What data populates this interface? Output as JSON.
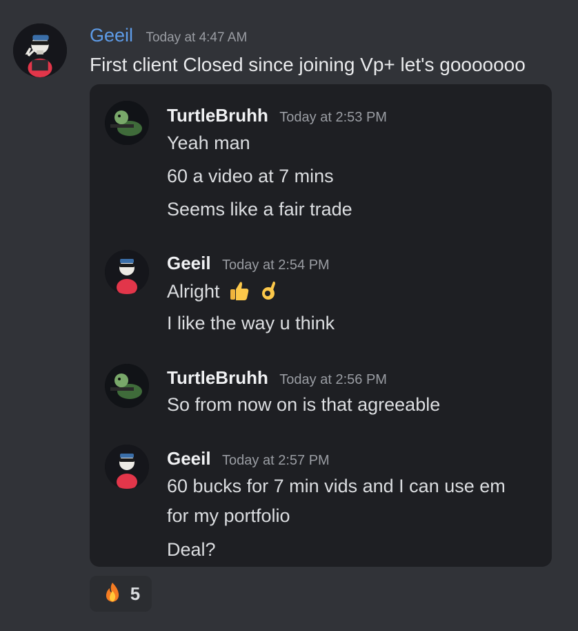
{
  "message": {
    "author": "Geeil",
    "timestamp": "Today at 4:47 AM",
    "text": "First client Closed since joining Vp+ let's gooooooo",
    "author_color": "#5e9ce8"
  },
  "quoted": [
    {
      "author": "TurtleBruhh",
      "timestamp": "Today at 2:53 PM",
      "avatar": "turtle-avatar",
      "lines": [
        "Yeah man",
        "60 a video at 7 mins",
        "Seems like a fair trade"
      ]
    },
    {
      "author": "Geeil",
      "timestamp": "Today at 2:54 PM",
      "avatar": "skeleton-avatar",
      "lines": [
        "Alright",
        "I like the way u think"
      ],
      "emojis": [
        "thumbs-up-icon",
        "ok-hand-icon"
      ]
    },
    {
      "author": "TurtleBruhh",
      "timestamp": "Today at 2:56 PM",
      "avatar": "turtle-avatar",
      "lines": [
        "So from now on is that agreeable"
      ]
    },
    {
      "author": "Geeil",
      "timestamp": "Today at 2:57 PM",
      "avatar": "skeleton-avatar",
      "lines": [
        "60 bucks for 7 min vids and I can use em",
        "for my portfolio",
        "Deal?"
      ]
    }
  ],
  "reaction": {
    "emoji": "fire-icon",
    "count": "5"
  }
}
